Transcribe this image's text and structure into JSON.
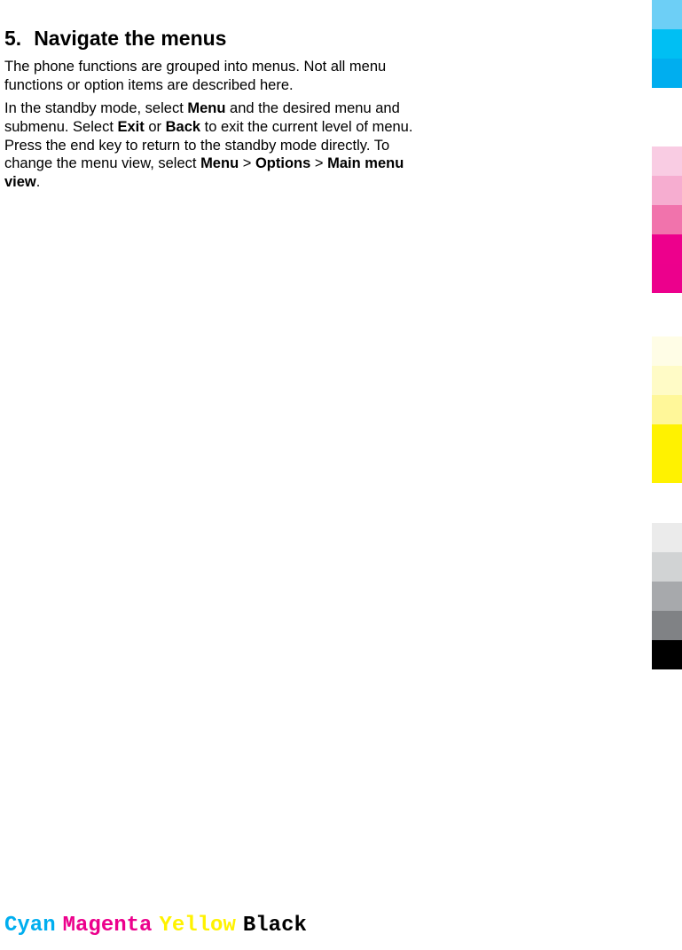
{
  "heading": {
    "number": "5.",
    "title": "Navigate the menus"
  },
  "paragraphs": {
    "p1": "The phone functions are grouped into menus. Not all menu functions or option items are described here.",
    "p2_part1": "In the standby mode, select ",
    "p2_bold1": "Menu",
    "p2_part2": " and the desired menu and submenu. Select ",
    "p2_bold2": "Exit",
    "p2_part3": " or ",
    "p2_bold3": "Back",
    "p2_part4": " to exit the current level of menu. Press the end key to return to the standby mode directly. To change the menu view, select ",
    "p2_bold4": "Menu",
    "p2_part5": "  >  ",
    "p2_bold5": "Options",
    "p2_part6": "  >  ",
    "p2_bold6": "Main menu view",
    "p2_part7": "."
  },
  "footer": {
    "cyan": "Cyan",
    "magenta": "Magenta",
    "yellow": "Yellow",
    "black": "Black"
  },
  "swatches": {
    "cyan": [
      "#6DCFF6",
      "#00BFF3",
      "#00AEEF"
    ],
    "magenta": [
      "#F9CCE3",
      "#F6ADD0",
      "#F173AC",
      "#ED008C",
      "#EC008C"
    ],
    "yellow": [
      "#FFFDE6",
      "#FFFBC6",
      "#FFF799",
      "#FFF200",
      "#FFF200"
    ],
    "black": [
      "#EBEBEB",
      "#D1D3D4",
      "#A7A9AC",
      "#808285",
      "#000000"
    ]
  }
}
